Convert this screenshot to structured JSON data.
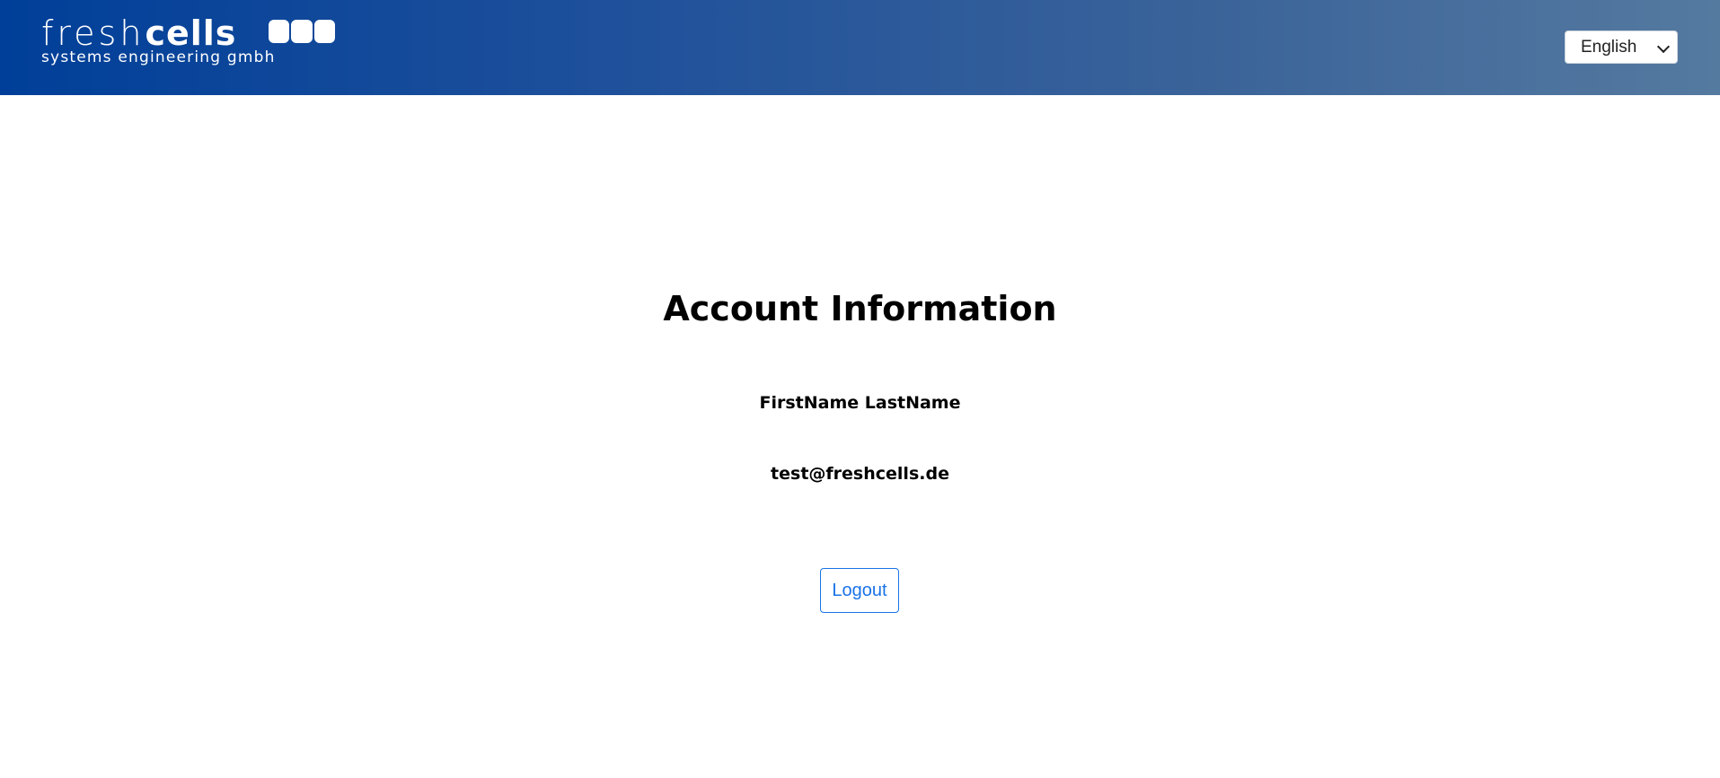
{
  "header": {
    "logo_text": "freshcells",
    "logo_text_light": "fresh",
    "logo_text_bold": "cells",
    "logo_tagline": "systems engineering gmbh",
    "language": {
      "selected": "English"
    },
    "colors": {
      "gradient_start": "#003f99",
      "gradient_end": "#557aa0"
    }
  },
  "main": {
    "title": "Account Information",
    "user_name": "FirstName LastName",
    "user_email": "test@freshcells.de",
    "logout_label": "Logout"
  },
  "colors": {
    "accent": "#1a73e8"
  }
}
